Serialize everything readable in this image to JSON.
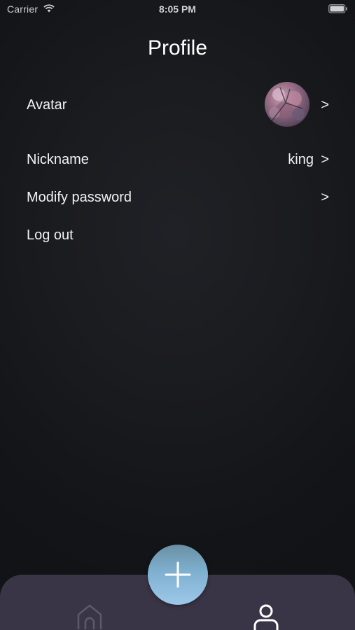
{
  "status_bar": {
    "carrier": "Carrier",
    "time": "8:05 PM",
    "wifi_icon": "wifi-icon",
    "battery_icon": "battery-icon"
  },
  "header": {
    "title": "Profile"
  },
  "settings": {
    "rows": [
      {
        "label": "Avatar",
        "chevron": ">",
        "icon": "avatar-image"
      },
      {
        "label": "Nickname",
        "value": "king",
        "chevron": ">"
      },
      {
        "label": "Modify password",
        "chevron": ">"
      },
      {
        "label": "Log out"
      }
    ]
  },
  "tab_bar": {
    "add_button_icon": "plus-icon",
    "home_icon": "home-icon",
    "profile_icon": "user-icon",
    "active_tab": "profile"
  },
  "colors": {
    "background": "#141519",
    "tab_bar": "#3a3546",
    "add_button_top": "#6a8fa3",
    "add_button_bottom": "#9dc8ea",
    "text": "#f2f2f4"
  }
}
